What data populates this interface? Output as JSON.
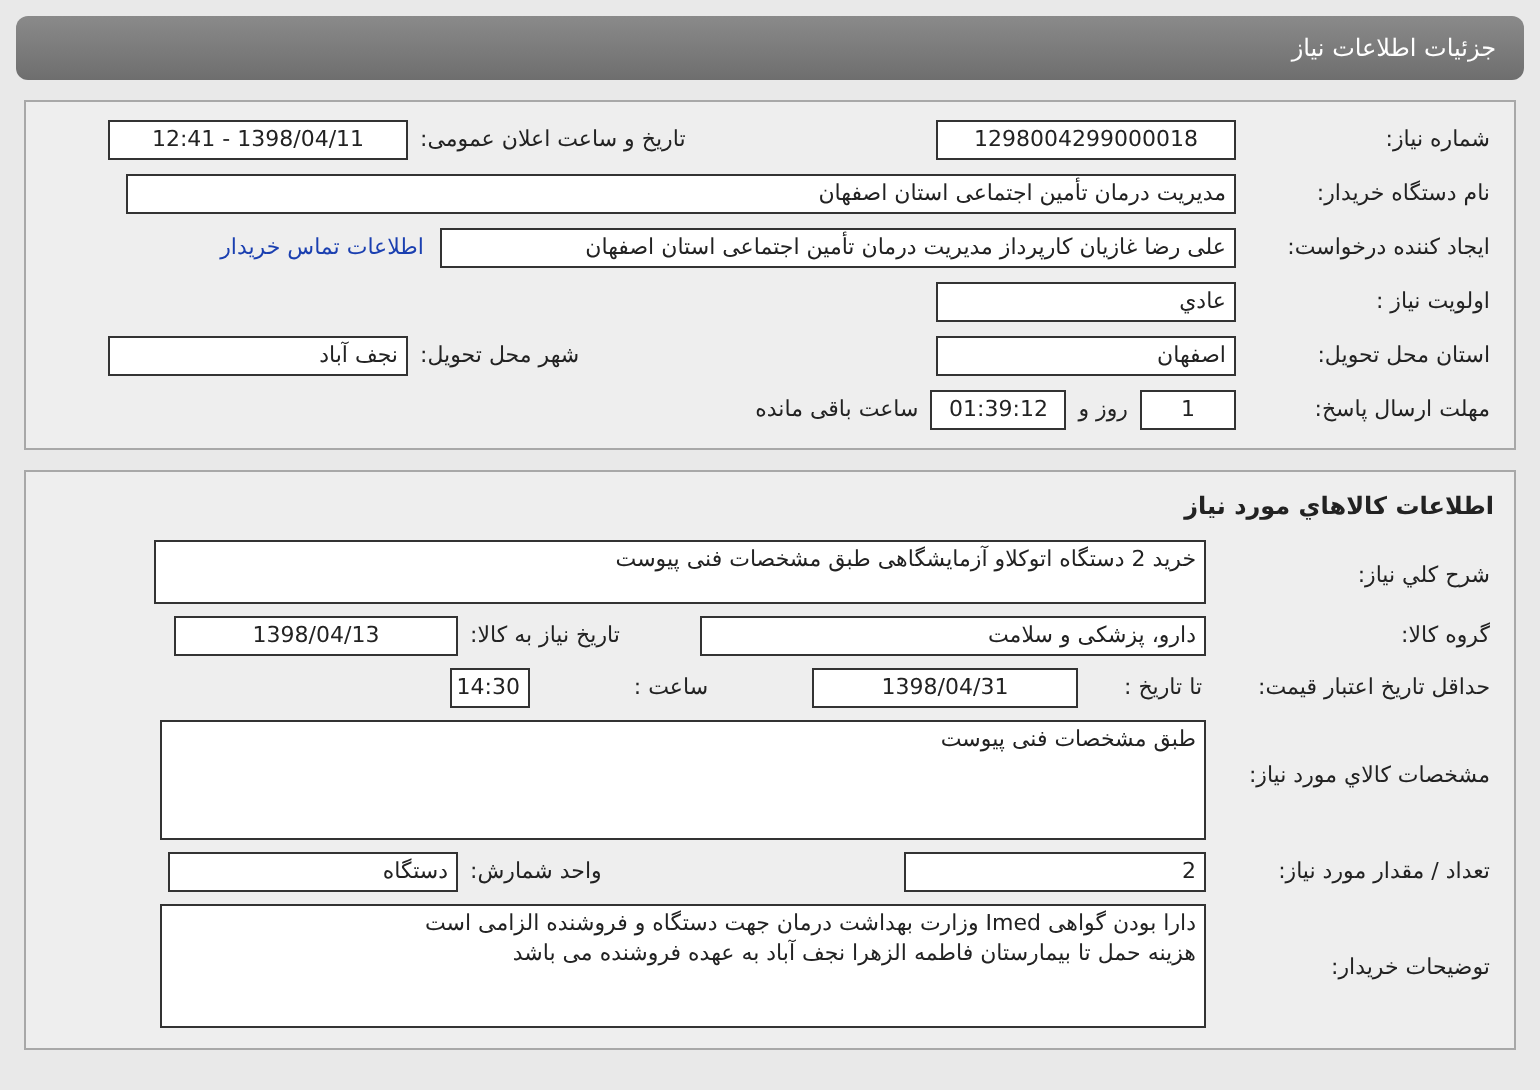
{
  "page_title": "جزئیات اطلاعات نیاز",
  "need_info": {
    "rows": [
      {
        "items": [
          {
            "kind": "label",
            "text": "شماره نیاز:"
          },
          {
            "kind": "field",
            "text": "1298004299000018"
          },
          {
            "kind": "label",
            "text": "تاریخ و ساعت اعلان عمومی:"
          },
          {
            "kind": "field",
            "text": "1398/04/11 - 12:41"
          }
        ]
      },
      {
        "items": [
          {
            "kind": "label",
            "text": "نام دستگاه خریدار:"
          },
          {
            "kind": "field",
            "text": "مدیریت درمان تأمین اجتماعی استان اصفهان"
          }
        ]
      },
      {
        "items": [
          {
            "kind": "label",
            "text": "ایجاد کننده درخواست:"
          },
          {
            "kind": "field",
            "text": "علی رضا غازیان کارپرداز مدیریت درمان تأمین اجتماعی استان اصفهان"
          },
          {
            "kind": "link",
            "text": "اطلاعات تماس خریدار"
          }
        ]
      },
      {
        "items": [
          {
            "kind": "label",
            "text": "اولویت نیاز :"
          },
          {
            "kind": "field",
            "text": "عادي"
          }
        ]
      },
      {
        "items": [
          {
            "kind": "label",
            "text": "استان محل تحویل:"
          },
          {
            "kind": "field",
            "text": "اصفهان"
          },
          {
            "kind": "label",
            "text": "شهر محل تحویل:"
          },
          {
            "kind": "field",
            "text": "نجف آباد"
          }
        ]
      },
      {
        "items": [
          {
            "kind": "label",
            "text": "مهلت ارسال پاسخ:"
          },
          {
            "kind": "field",
            "text": "1"
          },
          {
            "kind": "label",
            "text": "روز و"
          },
          {
            "kind": "field",
            "text": "01:39:12"
          },
          {
            "kind": "label",
            "text": "ساعت باقی مانده"
          }
        ]
      }
    ]
  },
  "goods_info": {
    "title": "اطلاعات کالاهاي مورد نیاز",
    "rows": [
      {
        "items": [
          {
            "kind": "label",
            "text": "شرح کلي نیاز:"
          },
          {
            "kind": "area",
            "lines": [
              "خرید 2 دستگاه اتوکلاو آزمایشگاهی طبق مشخصات فنی پیوست"
            ]
          }
        ]
      },
      {
        "items": [
          {
            "kind": "label",
            "text": "گروه کالا:"
          },
          {
            "kind": "field",
            "text": "دارو، پزشکی و سلامت"
          },
          {
            "kind": "label",
            "text": "تاریخ نیاز به کالا:"
          },
          {
            "kind": "field",
            "text": "1398/04/13"
          }
        ]
      },
      {
        "items": [
          {
            "kind": "label",
            "text": "حداقل تاریخ اعتبار قیمت:"
          },
          {
            "kind": "label",
            "text": "تا تاریخ :"
          },
          {
            "kind": "field",
            "text": "1398/04/31"
          },
          {
            "kind": "label",
            "text": "ساعت :"
          },
          {
            "kind": "field",
            "text": "14:30"
          }
        ]
      },
      {
        "items": [
          {
            "kind": "label",
            "text": "مشخصات کالاي مورد نیاز:"
          },
          {
            "kind": "area",
            "lines": [
              "طبق مشخصات فنی پیوست"
            ]
          }
        ]
      },
      {
        "items": [
          {
            "kind": "label",
            "text": "تعداد / مقدار مورد نیاز:"
          },
          {
            "kind": "field",
            "text": "2"
          },
          {
            "kind": "label",
            "text": "واحد شمارش:"
          },
          {
            "kind": "field",
            "text": "دستگاه"
          }
        ]
      },
      {
        "items": [
          {
            "kind": "label",
            "text": "توضیحات خریدار:"
          },
          {
            "kind": "area",
            "lines": [
              "دارا بودن گواهی Imed وزارت بهداشت درمان جهت دستگاه و فروشنده الزامی است",
              "هزینه حمل تا بیمارستان فاطمه الزهرا نجف آباد به عهده فروشنده می باشد"
            ]
          }
        ]
      }
    ]
  }
}
